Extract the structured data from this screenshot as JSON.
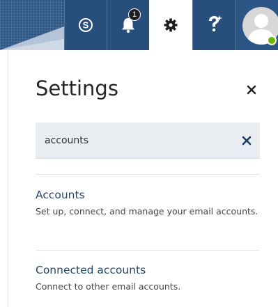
{
  "header": {
    "notification_count": "1",
    "icons": [
      "skype-icon",
      "bell-icon",
      "gear-icon",
      "help-icon",
      "avatar-icon"
    ],
    "colors": {
      "bar": "#284f7c",
      "active_tab": "#ffffff",
      "presence": "#6bb700"
    }
  },
  "settings": {
    "title": "Settings",
    "search": {
      "value": "accounts",
      "placeholder": ""
    },
    "results": [
      {
        "title": "Accounts",
        "description": "Set up, connect, and manage your email accounts."
      },
      {
        "title": "Connected accounts",
        "description": "Connect to other email accounts."
      }
    ]
  }
}
